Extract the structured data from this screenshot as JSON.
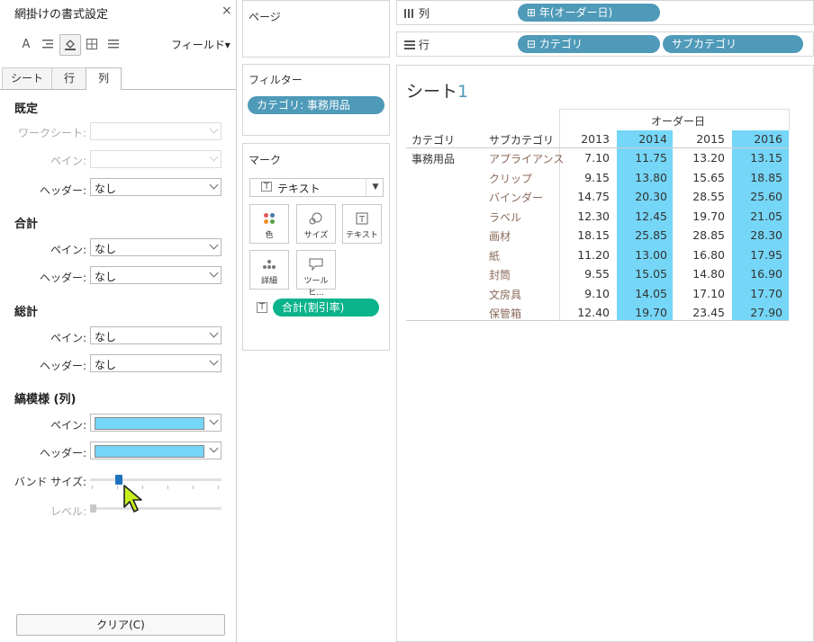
{
  "format_pane": {
    "title": "網掛けの書式設定",
    "close": "×",
    "fields_label": "フィールド▾",
    "tabs": [
      "シート",
      "行",
      "列"
    ],
    "sections": {
      "default": {
        "title": "既定",
        "worksheet_label": "ワークシート:",
        "pane_label": "ペイン:",
        "header_label": "ヘッダー:",
        "header_value": "なし"
      },
      "total": {
        "title": "合計",
        "pane_label": "ペイン:",
        "pane_value": "なし",
        "header_label": "ヘッダー:",
        "header_value": "なし"
      },
      "grand_total": {
        "title": "総計",
        "pane_label": "ペイン:",
        "pane_value": "なし",
        "header_label": "ヘッダー:",
        "header_value": "なし"
      },
      "banding": {
        "title": "縞模様 (列)",
        "pane_label": "ペイン:",
        "header_label": "ヘッダー:",
        "band_size_label": "バンド サイズ:",
        "level_label": "レベル:",
        "swatch_color": "#75d6f7"
      }
    },
    "clear_label": "クリア(C)"
  },
  "middle": {
    "pages_title": "ページ",
    "filters_title": "フィルター",
    "filter_pill": "カテゴリ: 事務用品",
    "marks_title": "マーク",
    "marks_type": "テキスト",
    "mark_buttons": [
      "色",
      "サイズ",
      "テキスト",
      "詳細",
      "ツールヒ..."
    ],
    "measure_pill": "合計(割引率)"
  },
  "shelves": {
    "columns_label": "列",
    "columns_pill": "⊞ 年(オーダー日)",
    "rows_label": "行",
    "rows_pill1": "⊟ カテゴリ",
    "rows_pill2": "サブカテゴリ"
  },
  "view": {
    "sheet_title": "シート",
    "sheet_num": "1",
    "col_group_header": "オーダー日",
    "row_header1": "カテゴリ",
    "row_header2": "サブカテゴリ",
    "category": "事務用品",
    "years": [
      "2013",
      "2014",
      "2015",
      "2016"
    ],
    "rows": [
      {
        "sub": "アプライアンス",
        "v": [
          "7.10",
          "11.75",
          "13.20",
          "13.15"
        ]
      },
      {
        "sub": "クリップ",
        "v": [
          "9.15",
          "13.80",
          "15.65",
          "18.85"
        ]
      },
      {
        "sub": "バインダー",
        "v": [
          "14.75",
          "20.30",
          "28.55",
          "25.60"
        ]
      },
      {
        "sub": "ラベル",
        "v": [
          "12.30",
          "12.45",
          "19.70",
          "21.05"
        ]
      },
      {
        "sub": "画材",
        "v": [
          "18.15",
          "25.85",
          "28.85",
          "28.30"
        ]
      },
      {
        "sub": "紙",
        "v": [
          "11.20",
          "13.00",
          "16.80",
          "17.95"
        ]
      },
      {
        "sub": "封筒",
        "v": [
          "9.55",
          "15.05",
          "14.80",
          "16.90"
        ]
      },
      {
        "sub": "文房具",
        "v": [
          "9.10",
          "14.05",
          "17.10",
          "17.70"
        ]
      },
      {
        "sub": "保管箱",
        "v": [
          "12.40",
          "19.70",
          "23.45",
          "27.90"
        ]
      }
    ],
    "highlight_color": "#75d6f7"
  }
}
